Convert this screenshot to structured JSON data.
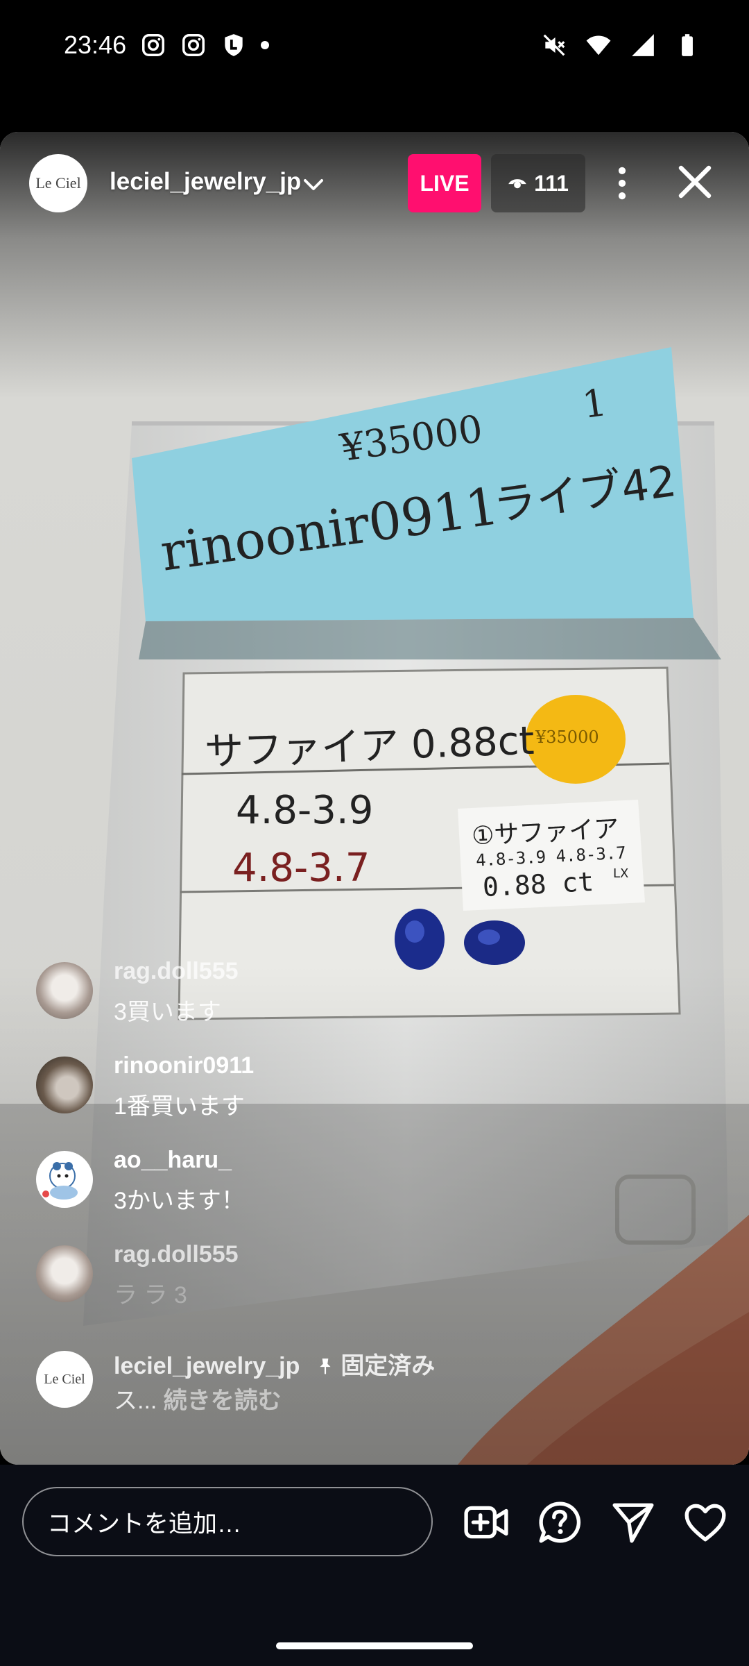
{
  "status_bar": {
    "time": "23:46",
    "left_icons": [
      "instagram-icon",
      "instagram-icon",
      "shield-l-icon",
      "notification-dot"
    ],
    "right_icons": [
      "mute-icon",
      "wifi-icon",
      "signal-icon",
      "battery-icon"
    ]
  },
  "header": {
    "host_avatar_text": "Le Ciel",
    "host_name": "leciel_jewelry_jp",
    "live_label": "LIVE",
    "viewer_count": "111"
  },
  "video": {
    "sticky_price": "¥35000",
    "sticky_number": "1",
    "sticky_user": "rinoonir0911",
    "sticky_live": "ライブ42",
    "card_title": "サファイア 0.88ct",
    "card_sticker": "¥35000",
    "card_dim1": "4.8-3.9",
    "card_dim2": "4.8-3.7",
    "label_line1": "①サファイア",
    "label_line2": "4.8-3.9 4.8-3.7",
    "label_line3": "0.88 ct",
    "label_mark": "LX"
  },
  "comments": [
    {
      "user": "rag.doll555",
      "text": "3買います"
    },
    {
      "user": "rinoonir0911",
      "text": "1番買います"
    },
    {
      "user": "ao__haru_",
      "text": "3かいます！"
    },
    {
      "user": "rag.doll555",
      "text": "ラ ラ 3"
    },
    {
      "user": "leciel_jewelry_jp",
      "pinned_label": "固定済み",
      "text": "ス...",
      "read_more": "続きを読む",
      "avatar_text": "Le Ciel"
    }
  ],
  "bottom_bar": {
    "comment_placeholder": "コメントを追加…"
  },
  "colors": {
    "live_pink": "#ff0f6f",
    "bar_bg": "#0b0d15",
    "sticky_blue": "#8fd0e0"
  }
}
